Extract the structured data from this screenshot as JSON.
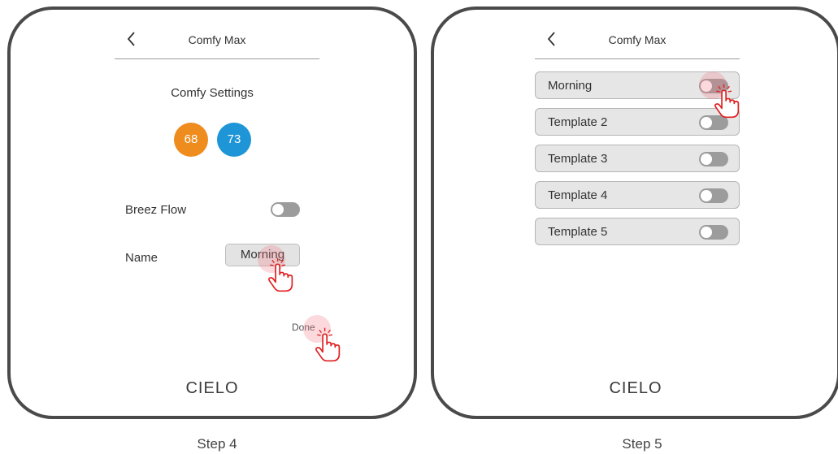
{
  "step4": {
    "header_title": "Comfy Max",
    "section_title": "Comfy Settings",
    "temp_low": "68",
    "temp_high": "73",
    "breez_flow_label": "Breez Flow",
    "name_label": "Name",
    "name_value": "Morning",
    "done_label": "Done",
    "logo": "CIELO",
    "step_label": "Step 4"
  },
  "step5": {
    "header_title": "Comfy Max",
    "templates": [
      {
        "label": "Morning"
      },
      {
        "label": "Template 2"
      },
      {
        "label": "Template 3"
      },
      {
        "label": "Template 4"
      },
      {
        "label": "Template 5"
      }
    ],
    "logo": "CIELO",
    "step_label": "Step 5"
  },
  "colors": {
    "temp_low": "#ef8c1e",
    "temp_high": "#1e95d6",
    "toggle_off": "#9c9c9c",
    "tap_highlight": "#f07882",
    "hand_cursor": "#e02020"
  },
  "icons": [
    "back-chevron-icon",
    "hand-pointer-icon",
    "tap-indicator-icon"
  ]
}
